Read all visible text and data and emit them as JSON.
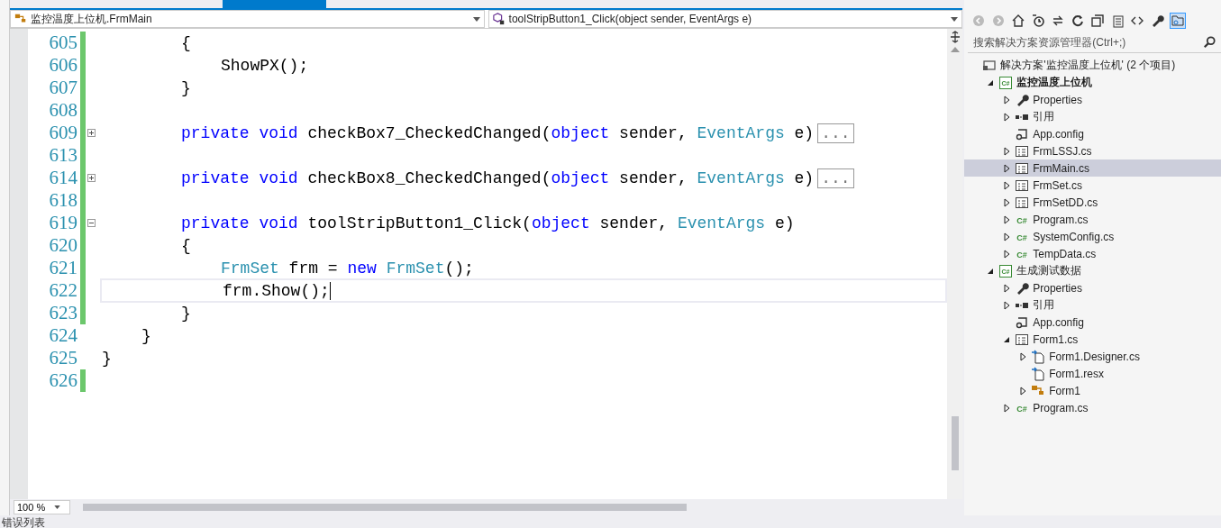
{
  "editor": {
    "nav": {
      "class_dropdown": "监控温度上位机.FrmMain",
      "member_dropdown": "toolStripButton1_Click(object sender, EventArgs e)"
    },
    "code": [
      {
        "children": [
          {
            "children": [
              {
                "number": "605",
                "changed": true,
                "current": false,
                "tokens": [
                  {
                    "kind": "plain",
                    "text": "{"
                  }
                ]
              },
              {
                "children": [
                  {
                    "number": "606",
                    "changed": true,
                    "current": false,
                    "tokens": [
                      {
                        "kind": "plain",
                        "text": "ShowPX();"
                      }
                    ]
                  }
                ]
              },
              {
                "number": "607",
                "changed": true,
                "current": false,
                "tokens": [
                  {
                    "kind": "plain",
                    "text": "}"
                  }
                ]
              },
              {
                "number": "608",
                "changed": true,
                "current": false
              },
              {
                "number": "609",
                "changed": true,
                "current": false,
                "collapsed": true,
                "tokens": [
                  {
                    "kind": "keyword",
                    "text": "private void"
                  },
                  {
                    "kind": "plain",
                    "text": " checkBox7_CheckedChanged("
                  },
                  {
                    "kind": "keyword",
                    "text": "object"
                  },
                  {
                    "kind": "plain",
                    "text": " sender, "
                  },
                  {
                    "kind": "type",
                    "text": "EventArgs"
                  },
                  {
                    "kind": "plain",
                    "text": " e)"
                  },
                  {
                    "kind": "collapsed",
                    "text": "..."
                  }
                ]
              },
              {
                "number": "613",
                "changed": true,
                "current": false
              },
              {
                "number": "614",
                "changed": true,
                "current": false,
                "collapsed": true,
                "tokens": [
                  {
                    "kind": "keyword",
                    "text": "private void"
                  },
                  {
                    "kind": "plain",
                    "text": " checkBox8_CheckedChanged("
                  },
                  {
                    "kind": "keyword",
                    "text": "object"
                  },
                  {
                    "kind": "plain",
                    "text": " sender, "
                  },
                  {
                    "kind": "type",
                    "text": "EventArgs"
                  },
                  {
                    "kind": "plain",
                    "text": " e)"
                  },
                  {
                    "kind": "collapsed",
                    "text": "..."
                  }
                ]
              },
              {
                "number": "618",
                "changed": true,
                "current": false
              },
              {
                "number": "619",
                "changed": true,
                "current": false,
                "collapsed": false,
                "tokens": [
                  {
                    "kind": "keyword",
                    "text": "private void"
                  },
                  {
                    "kind": "plain",
                    "text": " toolStripButton1_Click("
                  },
                  {
                    "kind": "keyword",
                    "text": "object"
                  },
                  {
                    "kind": "plain",
                    "text": " sender, "
                  },
                  {
                    "kind": "type",
                    "text": "EventArgs"
                  },
                  {
                    "kind": "plain",
                    "text": " e)"
                  }
                ]
              },
              {
                "number": "620",
                "changed": true,
                "current": false,
                "tokens": [
                  {
                    "kind": "plain",
                    "text": "{"
                  }
                ]
              },
              {
                "children": [
                  {
                    "number": "621",
                    "changed": true,
                    "current": false,
                    "tokens": [
                      {
                        "kind": "type",
                        "text": "FrmSet"
                      },
                      {
                        "kind": "plain",
                        "text": " frm = "
                      },
                      {
                        "kind": "keyword",
                        "text": "new"
                      },
                      {
                        "kind": "type",
                        "text": " FrmSet"
                      },
                      {
                        "kind": "plain",
                        "text": "();"
                      }
                    ]
                  },
                  {
                    "number": "622",
                    "changed": true,
                    "current": true,
                    "tokens": [
                      {
                        "kind": "plain",
                        "text": "frm.Show();"
                      }
                    ]
                  }
                ]
              },
              {
                "number": "623",
                "changed": true,
                "current": false,
                "tokens": [
                  {
                    "kind": "plain",
                    "text": "}"
                  }
                ]
              }
            ]
          },
          {
            "number": "624",
            "changed": false,
            "current": false,
            "tokens": [
              {
                "kind": "plain",
                "text": "}"
              }
            ]
          }
        ]
      },
      {
        "number": "625",
        "changed": false,
        "current": false,
        "tokens": [
          {
            "kind": "plain",
            "text": "}"
          }
        ]
      },
      {
        "number": "626",
        "changed": true,
        "current": false
      }
    ],
    "zoom": "100 %"
  },
  "solution_explorer": {
    "search": {
      "placeholder": "搜索解决方案资源管理器(Ctrl+;)"
    },
    "tree": [
      {
        "kind": "solution",
        "label": "解决方案'监控温度上位机' (2 个项目)",
        "selected": false,
        "bold": false,
        "children": [
          {
            "kind": "project",
            "icon_text": "C#",
            "label": "监控温度上位机",
            "expanded": true,
            "selected": false,
            "bold": true,
            "children": [
              {
                "kind": "properties",
                "label": "Properties",
                "expanded": false,
                "selected": false,
                "bold": false
              },
              {
                "kind": "references",
                "label": "引用",
                "expanded": false,
                "selected": false,
                "bold": false
              },
              {
                "kind": "config",
                "label": "App.config",
                "selected": false,
                "bold": false
              },
              {
                "kind": "form",
                "label": "FrmLSSJ.cs",
                "expanded": false,
                "selected": false,
                "bold": false
              },
              {
                "kind": "form",
                "label": "FrmMain.cs",
                "expanded": false,
                "selected": true,
                "bold": false
              },
              {
                "kind": "form",
                "label": "FrmSet.cs",
                "expanded": false,
                "selected": false,
                "bold": false
              },
              {
                "kind": "form",
                "label": "FrmSetDD.cs",
                "expanded": false,
                "selected": false,
                "bold": false
              },
              {
                "kind": "csharp",
                "icon_text": "C#",
                "label": "Program.cs",
                "expanded": false,
                "selected": false,
                "bold": false
              },
              {
                "kind": "csharp",
                "icon_text": "C#",
                "label": "SystemConfig.cs",
                "expanded": false,
                "selected": false,
                "bold": false
              },
              {
                "kind": "csharp",
                "icon_text": "C#",
                "label": "TempData.cs",
                "expanded": false,
                "selected": false,
                "bold": false
              }
            ]
          },
          {
            "kind": "project",
            "icon_text": "C#",
            "label": "生成测试数据",
            "expanded": true,
            "selected": false,
            "bold": false,
            "children": [
              {
                "kind": "properties",
                "label": "Properties",
                "expanded": false,
                "selected": false,
                "bold": false
              },
              {
                "kind": "references",
                "label": "引用",
                "expanded": false,
                "selected": false,
                "bold": false
              },
              {
                "kind": "config",
                "label": "App.config",
                "selected": false,
                "bold": false
              },
              {
                "kind": "form",
                "label": "Form1.cs",
                "expanded": true,
                "selected": false,
                "bold": false,
                "children": [
                  {
                    "kind": "file",
                    "label": "Form1.Designer.cs",
                    "expanded": false,
                    "selected": false,
                    "bold": false
                  },
                  {
                    "kind": "file",
                    "label": "Form1.resx",
                    "selected": false,
                    "bold": false
                  },
                  {
                    "kind": "class",
                    "label": "Form1",
                    "expanded": false,
                    "selected": false,
                    "bold": false
                  }
                ]
              },
              {
                "kind": "csharp",
                "icon_text": "C#",
                "label": "Program.cs",
                "expanded": false,
                "selected": false,
                "bold": false
              }
            ]
          }
        ]
      }
    ]
  },
  "bottom_panel": {
    "title": "错误列表"
  }
}
